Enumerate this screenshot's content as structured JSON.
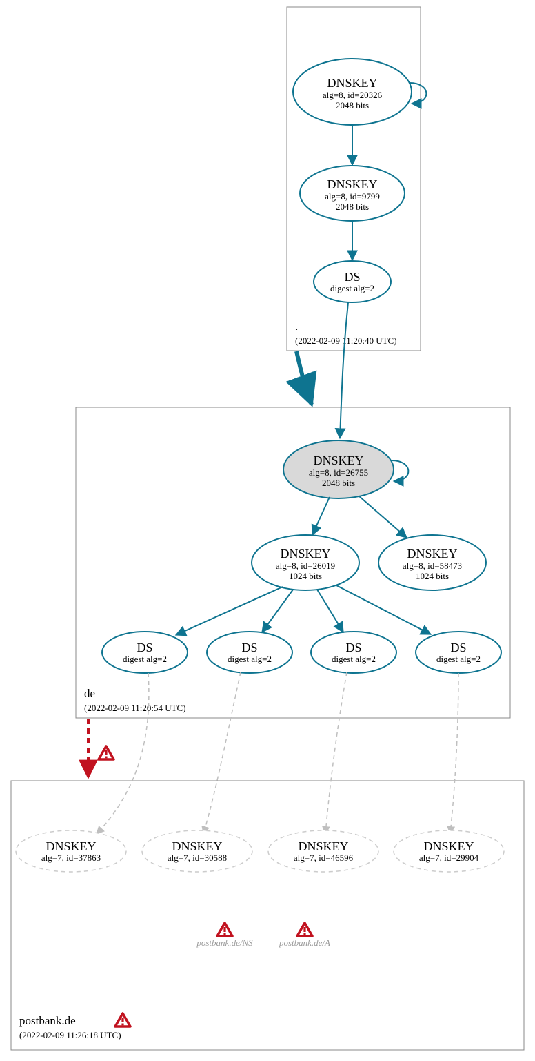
{
  "zones": {
    "root": {
      "label": ".",
      "date": "(2022-02-09 11:20:40 UTC)"
    },
    "de": {
      "label": "de",
      "date": "(2022-02-09 11:20:54 UTC)"
    },
    "postbank": {
      "label": "postbank.de",
      "date": "(2022-02-09 11:26:18 UTC)"
    }
  },
  "nodes": {
    "root_ksk": {
      "t": "DNSKEY",
      "l1": "alg=8, id=20326",
      "l2": "2048 bits"
    },
    "root_zsk": {
      "t": "DNSKEY",
      "l1": "alg=8, id=9799",
      "l2": "2048 bits"
    },
    "root_ds": {
      "t": "DS",
      "l1": "digest alg=2",
      "l2": ""
    },
    "de_ksk": {
      "t": "DNSKEY",
      "l1": "alg=8, id=26755",
      "l2": "2048 bits"
    },
    "de_zsk1": {
      "t": "DNSKEY",
      "l1": "alg=8, id=26019",
      "l2": "1024 bits"
    },
    "de_zsk2": {
      "t": "DNSKEY",
      "l1": "alg=8, id=58473",
      "l2": "1024 bits"
    },
    "de_ds1": {
      "t": "DS",
      "l1": "digest alg=2",
      "l2": ""
    },
    "de_ds2": {
      "t": "DS",
      "l1": "digest alg=2",
      "l2": ""
    },
    "de_ds3": {
      "t": "DS",
      "l1": "digest alg=2",
      "l2": ""
    },
    "de_ds4": {
      "t": "DS",
      "l1": "digest alg=2",
      "l2": ""
    },
    "pb_k1": {
      "t": "DNSKEY",
      "l1": "alg=7, id=37863",
      "l2": ""
    },
    "pb_k2": {
      "t": "DNSKEY",
      "l1": "alg=7, id=30588",
      "l2": ""
    },
    "pb_k3": {
      "t": "DNSKEY",
      "l1": "alg=7, id=46596",
      "l2": ""
    },
    "pb_k4": {
      "t": "DNSKEY",
      "l1": "alg=7, id=29904",
      "l2": ""
    }
  },
  "queries": {
    "ns": "postbank.de/NS",
    "a": "postbank.de/A"
  }
}
